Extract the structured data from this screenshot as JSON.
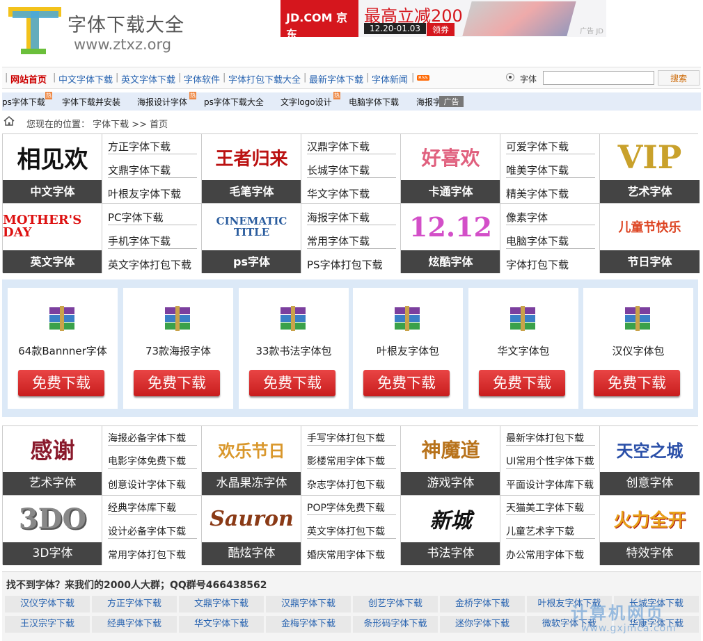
{
  "header": {
    "site_name": "字体下载大全",
    "site_url": "www.ztxz.org",
    "ad": {
      "logo": "JD.COM 京东",
      "headline": "最高立减200",
      "date": "12.20-01.03",
      "button": "领券",
      "tag": "广告 JD"
    }
  },
  "nav": {
    "items": [
      "网站首页",
      "中文字体下载",
      "英文字体下载",
      "字体软件",
      "字体打包下载大全",
      "最新字体下载",
      "字体新闻"
    ],
    "rss": "RSS",
    "search_option": "字体",
    "search_button": "搜索"
  },
  "tags": {
    "items": [
      "ps字体下载",
      "字体下载并安装",
      "海报设计字体",
      "ps字体下载大全",
      "文字logo设计",
      "电脑字体下载",
      "海报字"
    ],
    "hot": "热",
    "ad_label": "广告"
  },
  "breadcrumb": {
    "text": "您现在的位置： 字体下载 >> 首页"
  },
  "grid1": {
    "cells": [
      {
        "art": "相见欢",
        "label": "中文字体",
        "links": [
          "方正字体下载",
          "文鼎字体下载",
          "叶根友字体下载"
        ]
      },
      {
        "art": "王者归来",
        "label": "毛笔字体",
        "links": [
          "汉鼎字体下载",
          "长城字体下载",
          "华文字体下载"
        ]
      },
      {
        "art": "好喜欢",
        "label": "卡通字体",
        "links": [
          "可爱字体下载",
          "唯美字体下载",
          "精美字体下载"
        ]
      },
      {
        "art": "VIP",
        "label": "艺术字体"
      },
      {
        "art": "MOTHER'S DAY",
        "label": "英文字体",
        "links": [
          "PC字体下载",
          "手机字体下载",
          "英文字体打包下载"
        ]
      },
      {
        "art": "CINEMATIC TITLE",
        "label": "ps字体",
        "links": [
          "海报字体下载",
          "常用字体下载",
          "PS字体打包下载"
        ]
      },
      {
        "art": "12.12",
        "label": "炫酷字体",
        "links": [
          "像素字体",
          "电脑字体下载",
          "字体打包下载"
        ]
      },
      {
        "art": "儿童节快乐",
        "label": "节日字体"
      }
    ]
  },
  "downloads": {
    "button": "免费下载",
    "items": [
      "64款Bannner字体",
      "73款海报字体",
      "33款书法字体包",
      "叶根友字体包",
      "华文字体包",
      "汉仪字体包"
    ]
  },
  "grid2": {
    "cells": [
      {
        "art": "感谢",
        "label": "艺术字体",
        "links": [
          "海报必备字体下载",
          "电影字体免费下载",
          "创意设计字体下载"
        ]
      },
      {
        "art": "欢乐节日",
        "label": "水晶果冻字体",
        "links": [
          "手写字体打包下载",
          "影楼常用字体下载",
          "杂志字体打包下载"
        ]
      },
      {
        "art": "神魔道",
        "label": "游戏字体",
        "links": [
          "最新字体打包下载",
          "UI常用个性字体下载",
          "平面设计字体库下载"
        ]
      },
      {
        "art": "天空之城",
        "label": "创意字体"
      },
      {
        "art": "3DO",
        "label": "3D字体",
        "links": [
          "经典字体库下载",
          "设计必备字体下载",
          "常用字体打包下载"
        ]
      },
      {
        "art": "Sauron",
        "label": "酷炫字体",
        "links": [
          "POP字体免费下载",
          "英文字体打包下载",
          "婚庆常用字体下载"
        ]
      },
      {
        "art": "新城",
        "label": "书法字体",
        "links": [
          "天猫美工字体下载",
          "儿童艺术字下载",
          "办公常用字体下载"
        ]
      },
      {
        "art": "火力全开",
        "label": "特效字体"
      }
    ]
  },
  "bottom": {
    "title": "找不到字体？来我们的2000人大群；QQ群号466438562",
    "row1": [
      "汉仪字体下载",
      "方正字体下载",
      "文鼎字体下载",
      "汉鼎字体下载",
      "创艺字体下载",
      "金桥字体下载",
      "叶根友字体下载",
      "长城字体下载"
    ],
    "row2": [
      "王汉宗字下载",
      "经典字体下载",
      "华文字体下载",
      "金梅字体下载",
      "条形码字体下载",
      "迷你字体下载",
      "微软字体下载",
      "华康字体下载"
    ]
  },
  "watermark": {
    "line1": "计算机网页",
    "line2": "www.gxjmca.com"
  },
  "colors": {
    "nav_link": "#2662b0",
    "label_bg": "#444444",
    "download_red": "#d42626",
    "download_area": "#dce9f7"
  }
}
